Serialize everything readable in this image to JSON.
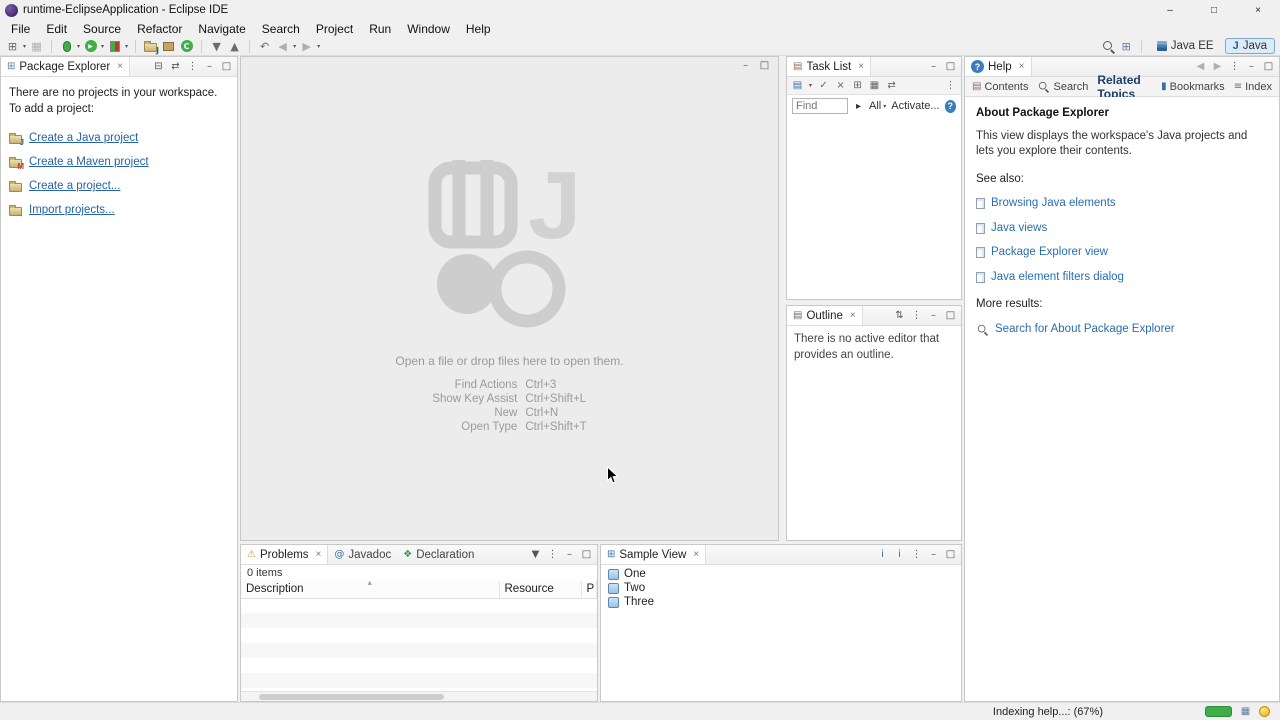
{
  "window": {
    "title": "runtime-EclipseApplication - Eclipse IDE"
  },
  "menubar": {
    "items": [
      "File",
      "Edit",
      "Source",
      "Refactor",
      "Navigate",
      "Search",
      "Project",
      "Run",
      "Window",
      "Help"
    ]
  },
  "toolbar": {
    "perspective_java_ee": "Java EE",
    "perspective_java": "Java"
  },
  "package_explorer": {
    "title": "Package Explorer",
    "empty_line1": "There are no projects in your workspace.",
    "empty_line2": "To add a project:",
    "links": [
      "Create a Java project",
      "Create a Maven project",
      "Create a project...",
      "Import projects..."
    ]
  },
  "editor": {
    "drop_hint": "Open a file or drop files here to open them.",
    "shortcuts": [
      {
        "action": "Find Actions",
        "keys": "Ctrl+3"
      },
      {
        "action": "Show Key Assist",
        "keys": "Ctrl+Shift+L"
      },
      {
        "action": "New",
        "keys": "Ctrl+N"
      },
      {
        "action": "Open Type",
        "keys": "Ctrl+Shift+T"
      }
    ]
  },
  "task_list": {
    "title": "Task List",
    "find_placeholder": "Find",
    "scope_label": "All",
    "activate_label": "Activate..."
  },
  "outline": {
    "title": "Outline",
    "empty_message": "There is no active editor that provides an outline."
  },
  "help": {
    "title": "Help",
    "tabs": [
      "Contents",
      "Search",
      "Related Topics",
      "Bookmarks",
      "Index"
    ],
    "active_tab": "Related Topics",
    "heading": "About Package Explorer",
    "body": "This view displays the workspace's Java projects and lets you explore their contents.",
    "see_also_label": "See also:",
    "links": [
      "Browsing Java elements",
      "Java views",
      "Package Explorer view",
      "Java element filters dialog"
    ],
    "more_results_label": "More results:",
    "search_link": "Search for About Package Explorer"
  },
  "problems": {
    "tabs": [
      "Problems",
      "Javadoc",
      "Declaration"
    ],
    "active_tab": "Problems",
    "items_label": "0 items",
    "columns": [
      "Description",
      "Resource",
      "P"
    ]
  },
  "sample_view": {
    "title": "Sample View",
    "items": [
      "One",
      "Two",
      "Three"
    ]
  },
  "status_bar": {
    "indexing_label": "Indexing help...: (67%)",
    "progress_percent": 67
  },
  "colors": {
    "link": "#2563a8",
    "active_perspective_bg": "#dcebf8",
    "progress_green": "#3fae49"
  },
  "icons": {
    "close": "×",
    "minimize": "–",
    "maximize": "□",
    "view_menu": "⋮",
    "dropdown": "▾",
    "collapse_all": "⊟",
    "link_editor": "⇄",
    "back": "◀",
    "forward": "▶",
    "run": "▶",
    "up": "▲",
    "down": "▼",
    "check": "✓",
    "delete": "×",
    "grid": "⊞",
    "grid_filled": "▦",
    "list": "▤",
    "sort_updown": "⇅",
    "undo": "↶",
    "expand": "▸",
    "question": "?",
    "info": "i",
    "sort": "▴",
    "warning": "⚠",
    "at": "@",
    "declaration": "❖",
    "funnel": "▼",
    "class_letter": "C",
    "java_letter": "J",
    "maven_letter": "M",
    "arrow_right": "→",
    "bookmark": "▮",
    "index": "≡",
    "new_wizard": "⊞"
  }
}
